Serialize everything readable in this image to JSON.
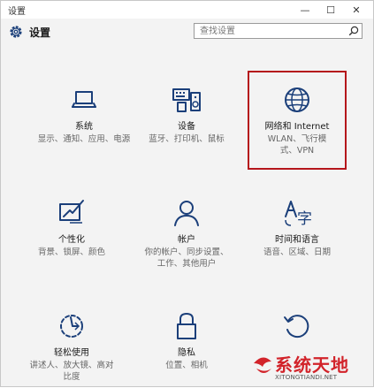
{
  "window": {
    "title": "设置"
  },
  "titlebar_buttons": {
    "minimize": "—",
    "maximize": "☐",
    "close": "✕"
  },
  "header": {
    "title": "设置",
    "icon": "gear-icon"
  },
  "search": {
    "placeholder": "查找设置",
    "icon": "search-icon"
  },
  "tiles": [
    {
      "label": "系统",
      "desc": "显示、通知、应用、电源",
      "icon": "laptop-icon"
    },
    {
      "label": "设备",
      "desc": "蓝牙、打印机、鼠标",
      "icon": "keyboard-speaker-icon"
    },
    {
      "label": "网络和 Internet",
      "desc": "WLAN、飞行模式、VPN",
      "icon": "globe-icon",
      "highlighted": true
    },
    {
      "label": "个性化",
      "desc": "背景、锁屏、颜色",
      "icon": "paint-icon"
    },
    {
      "label": "帐户",
      "desc": "你的帐户、同步设置、工作、其他用户",
      "icon": "person-icon"
    },
    {
      "label": "时间和语言",
      "desc": "语音、区域、日期",
      "icon": "language-icon"
    },
    {
      "label": "轻松使用",
      "desc": "讲述人、放大镜、高对比度",
      "icon": "accessibility-icon"
    },
    {
      "label": "隐私",
      "desc": "位置、相机",
      "icon": "lock-icon"
    },
    {
      "label": "更新和安全",
      "desc": "",
      "icon": "update-icon"
    }
  ],
  "watermark": {
    "main": "系统天地",
    "sub": "XITONGTIANDI.NET"
  },
  "colors": {
    "accent": "#1b3f7a",
    "highlight": "#b5161b",
    "watermark": "#d2232a"
  }
}
